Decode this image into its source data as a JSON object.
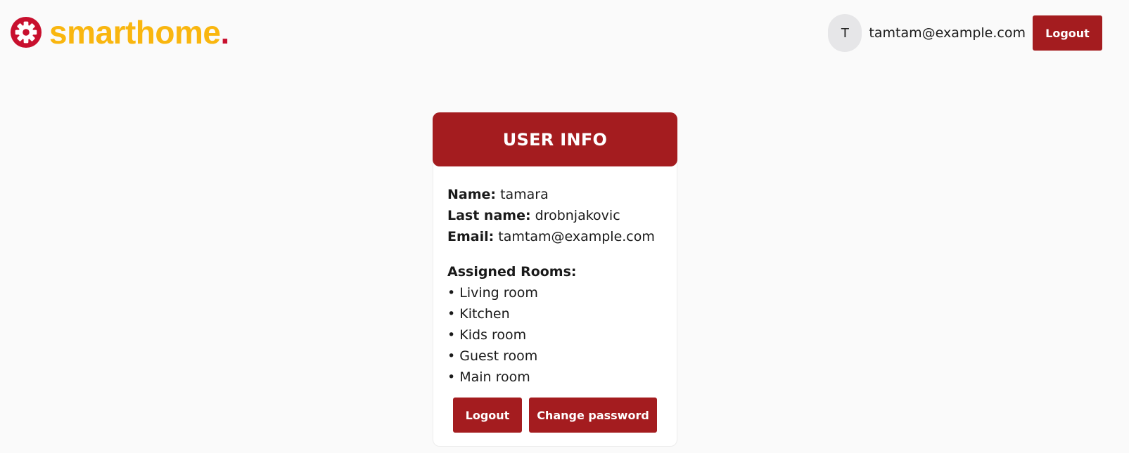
{
  "header": {
    "logo_text": "smarthome",
    "logo_dot": ".",
    "logo_icon": "gear-icon",
    "avatar_initial": "T",
    "user_email": "tamtam@example.com",
    "logout_label": "Logout"
  },
  "card": {
    "title": "USER INFO",
    "name_label": "Name:",
    "name_value": "tamara",
    "last_name_label": "Last name:",
    "last_name_value": "drobnjakovic",
    "email_label": "Email:",
    "email_value": "tamtam@example.com",
    "rooms_label": "Assigned Rooms:",
    "rooms": [
      "• Living room",
      "• Kitchen",
      "• Kids room",
      "• Guest room",
      "• Main room"
    ],
    "logout_label": "Logout",
    "change_password_label": "Change password"
  },
  "colors": {
    "brand_red": "#a41c1f",
    "logo_yellow": "#f9b60f",
    "logo_dot_red": "#c8102e",
    "background": "#fafafa"
  }
}
